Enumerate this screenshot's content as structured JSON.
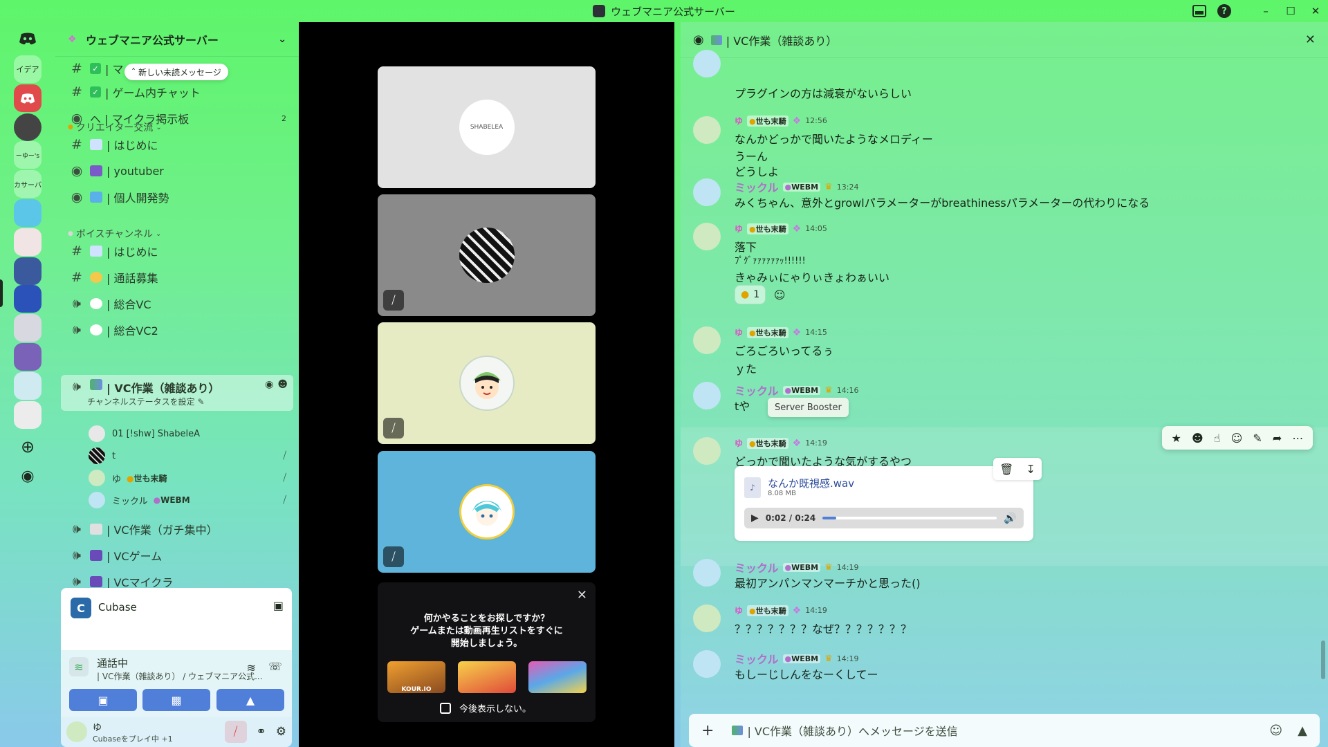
{
  "window": {
    "title": "ウェブマニア公式サーバー"
  },
  "rail": {
    "labels": [
      "イデア",
      "ーゆー's",
      "カサーバ"
    ]
  },
  "server": {
    "name": "ウェブマニア公式サーバー",
    "unread_pill": "新しい未読メッセージ"
  },
  "channels_top": [
    {
      "prefix": "#",
      "name": "| マ"
    },
    {
      "prefix": "#",
      "name": "| ゲーム内チャット"
    },
    {
      "prefix": "forum",
      "name": "ヘ | マイクラ掲示板",
      "count": "2"
    }
  ],
  "categories": {
    "creator": "クリエイター交流",
    "voice": "ボイスチャンネル"
  },
  "channels_creator": [
    {
      "name": "| はじめに"
    },
    {
      "name": "| youtuber"
    },
    {
      "name": "| 個人開発勢"
    }
  ],
  "channels_voice": [
    {
      "name": "| はじめに"
    },
    {
      "name": "| 通話募集"
    },
    {
      "name": "| 総合VC"
    },
    {
      "name": "| 総合VC2"
    }
  ],
  "active_vc": {
    "name": "| VC作業（雑談あり）",
    "status": "チャンネルステータスを設定"
  },
  "vc_users": [
    {
      "name": "01 [!shw] ShabeleA"
    },
    {
      "name": "t"
    },
    {
      "name": "ゆ",
      "badge": "世も末騎"
    },
    {
      "name": "ミックル",
      "badge": "WEBM"
    }
  ],
  "channels_after": [
    {
      "name": "| VC作業（ガチ集中）"
    },
    {
      "name": "| VCゲーム"
    },
    {
      "name": "| VCマイクラ"
    }
  ],
  "activity": {
    "app": "Cubase"
  },
  "voice_panel": {
    "status": "通話中",
    "location": "| VC作業（雑談あり） / ウェブマニア公式..."
  },
  "user_panel": {
    "name": "ゆ",
    "activity": "Cubaseをプレイ中 +1"
  },
  "stage": {
    "tile1_label": "SHABELEA",
    "activities_msg_1": "何かやることをお探しですか？",
    "activities_msg_2": "ゲームまたは動画再生リストをすぐに",
    "activities_msg_3": "開始しましょう。",
    "game1": "KOUR.IO",
    "dont_show": "今後表示しない。"
  },
  "chat": {
    "header": "| VC作業（雑談あり）",
    "tooltip": "Server Booster",
    "badge_yu": "世も末騎",
    "badge_mk": "WEBM",
    "name_yu": "ゆ",
    "name_mk": "ミックル",
    "messages": {
      "m0_line": "プラグインの方は減衰がないらしい",
      "m1_time": "12:56",
      "m1_l1": "なんかどっかで聞いたようなメロディー",
      "m1_l2": "うーん",
      "m1_l3": "どうしよ",
      "m2_time": "13:24",
      "m2_l1": "みくちゃん、意外とgrowlパラメーターがbreathinessパラメーターの代わりになる",
      "m3_time": "14:05",
      "m3_l1": "落下",
      "m3_l2": "ﾌﾟｸﾞｧｧｧｧｧｧｯ!!!!!!",
      "m3_l3": "きゃみぃにゃりぃきょわぁいい",
      "m3_react_count": "1",
      "m4_time": "14:15",
      "m4_l1": "ごろごろいってるぅ",
      "m4_l2": "ｙた",
      "m5_time": "14:16",
      "m5_l1": "tや",
      "m6_time": "14:19",
      "m6_l1": "どっかで聞いたような気がするやつ",
      "m7_time": "14:19",
      "m7_l1": "最初アンパンマンマーチかと思った()",
      "m8_time": "14:19",
      "m8_l1": "？？？？？？？なぜ？？？？？？？",
      "m9_time": "14:19",
      "m9_l1": "もしーじしんをなーくしてー"
    },
    "attachment": {
      "filename": "なんか既視感.wav",
      "size": "8.08 MB",
      "time": "0:02 / 0:24",
      "progress": 0.08
    },
    "composer_placeholder": "| VC作業（雑談あり）へメッセージを送信"
  },
  "colors": {
    "accent": "#4f7fd8",
    "username_yu": "#e050c8",
    "username_mk": "#b06fc9"
  }
}
